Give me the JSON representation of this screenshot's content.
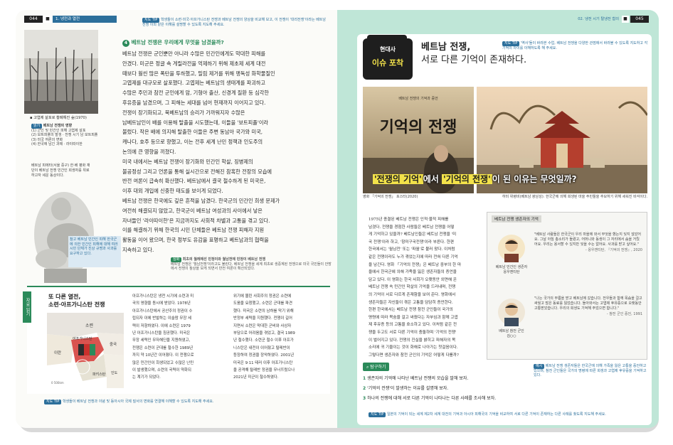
{
  "left_header": {
    "page": "044",
    "section_marker": "■",
    "chapter": "1. 냉전과 열전"
  },
  "right_header": {
    "chapter": "02. 냉전 시기 탈냉전 합의",
    "section_marker": "■",
    "page": "045"
  },
  "left_top_tip": {
    "tag": "지도 TIP",
    "text": "학생들이 소련·미국·아프가니스탄 전쟁과 베트남 전쟁의 양상을 비교해 보고, 이 전쟁이 '대리전쟁'이라는 베트남 전쟁 이외 같은 이해를 설명할 수 있도록 지도해 주세요."
  },
  "section4": {
    "num": "4",
    "title": "베트남 전쟁은 우리에게 무엇을 남겼을까?"
  },
  "left_body": [
    "베트남 전쟁은 군인뿐만 아니라 수많은 민간인에게도 막대한 피해를",
    "안겼다. 미군은 정글 속 게릴라전을 억제하기 위해 제초제 세계 대전",
    "때보다 훨씬 많은 폭탄을 투하했고, 밀림 제거를 위해 맹독성 화학물질인",
    "고엽제를 대규모로 살포했다. 고엽제는 베트남의 생태계를 파괴하고",
    "수많은 주민과 참전 군인에게 암, 기형아 출산, 신경계 질환 등 심각한",
    "후유증을 남겼으며, 그 피해는 세대를 넘어 현재까지 이어지고 있다.",
    "전쟁이 장기화되고, 북베트남의 승리가 가까워지자 수많은",
    "남베트남인이 배를 이용해 탈출을 시도했는데, 이들을 '보트피플'이라",
    "불렀다. 작은 배에 의지해 탈출한 이들은 주변 동남아 국가와 미국,",
    "캐나다, 호주 등으로 향했고, 이는 전후 세계 난민 정책과 인도주의",
    "논의에 큰 영향을 끼쳤다.",
    "미국 내에서는 베트남 전쟁이 장기화와 민간인 학살, 징병제의",
    "불공정성 그리고 언론을 통해 실시간으로 전해진 참혹한 전장의 모습에",
    "반전 여론이 급속히 확산했다. 베트남에서 결국 철수하게 된 미국은,",
    "이후 대외 개입에 신중한 태도를 보이게 되었다.",
    "베트남 전쟁은 한국에도 깊은 흔적을 남겼다. 한국군의 민간인 희생 문제가",
    "여전히 해결되지 않았고, 한국군이 베트남 여성과의 사이에서 낳은",
    "자녀들인 '라이따이한'은 지금까지도 사회적 차별과 고통을 겪고 있다.",
    "이를 해결하기 위해 한국의 시민 단체들은 베트남 전쟁 피해자 지원",
    "활동을 이어 왔으며, 한국 정부도 유감을 표명하고 베트남과의 협력을",
    "지속하고 있다."
  ],
  "photo1_caption": "고엽제 살포로 황폐해진 숲(1970)",
  "photo1_notes": {
    "tag": "읽기",
    "title": "베트남 전쟁의 영향",
    "items": [
      "(1) 군인 및 민간인 피해 고엽제 살포",
      "(2) 보트피플의 발생 · 전쟁 시기 남 보트피플",
      "(3) 미국 여론의 변화",
      "(4) 한국에 남긴 과제 · 라이따이한"
    ]
  },
  "statue_caption": "베트남 피에타(서울 중구) 한·베 평화 재단이 베트남 전쟁 민간인 희생자를 위로하고자 세운 동상이다.",
  "statue_note": "참고 베트남 민간인 피해 한국군에 의한 민간인 피해에 대해 여러 시민 단체가 진상 규명과 사과를 요구하고 있다.",
  "green_tip": {
    "tag": "심화",
    "title": "최초의 월레에선 민정이와 월남전에 민정이 베트남 전쟁",
    "text": "베트남 전쟁은 '월남전쟁'이라고도 불린다. 베트남 전쟁을 세계 최초로 생중계된 전쟁으로 미국 국민들이 안방에서 전쟁의 참상을 보게 되면서 반전 여론이 확산되었다."
  },
  "left_sidebar_label": "자료 읽기",
  "box2": {
    "title_line1": "또 다른 열전,",
    "title_line2": "소련·아프가니스탄 전쟁"
  },
  "map_labels": {
    "ussr": "소련",
    "afghanistan": "아프가니스탄",
    "iran": "이란",
    "china": "중국",
    "pakistan": "파키스탄",
    "india": "인도",
    "scale": "0 500km"
  },
  "box2_col1": [
    "아프가니스탄은 냉전 시기에 소련과 미",
    "국의 영향을 동시에 받았다. 1978년",
    "아프가니스탄에서 공산주의 정권이 수",
    "립되자 이에 반발하는 이슬람 무장 세",
    "력이 저항하였다. 이에 소련은 1979",
    "년 아프가니스탄을 침공했다. 미국은",
    "무장 세력인 무자헤딘을 지원하였고,",
    "전쟁은 소련이 군대를 철수한 1989년",
    "까지 약 10년간 이어졌다. 이 전쟁으로",
    "많은 민간인이 희생되었고 수많은 난민",
    "이 발생했으며, 소련의 국력이 약화되",
    "는 계기가 되었다."
  ],
  "box2_col2": [
    "위기에 몰린 사회주의 정권은 소련에",
    "도움을 요청했고, 소련은 군대를 파견",
    "했다. 미국은 소련의 남하를 막기 위해",
    "반정부 세력을 지원했다. 전쟁이 길어",
    "지면서 소련은 막대한 군비와 사상자",
    "부담으로 어려움을 겪었고, 결국 1989",
    "년 철수했다. 소련군 철수 이후 아프가",
    "니스탄은 내전이 이어졌고 탈레반이",
    "등장하여 정권을 장악하였다. 2001년",
    "미국은 9·11 테러 이후 아프가니스탄",
    "을 공격해 탈레반 정권을 무너뜨렸으나",
    "2021년 미군이 철수하였다."
  ],
  "left_bottom_tip": {
    "tag": "지도 TIP",
    "text": "학생들이 베트남 전쟁과 이념 및 동아시아 국제 질서의 변화를 연결해 이해할 수 있도록 지도해 주세요."
  },
  "badge": {
    "line1": "현대사",
    "line2": "이슈 포착"
  },
  "right_title": {
    "line1": "베트남 전쟁,",
    "line2": "서로 다른 기억이 존재하다."
  },
  "right_title_tip": {
    "tag": "지도 TIP",
    "text": "'역사'들이 바라본 수업, 베트남 전쟁을 다양한 관점에서 바라볼 수 있도록 지도하고 각 기억의 차이를 이해하도록 해 주세요."
  },
  "poster": {
    "small_text": "베트남 전쟁의 기억과 증언",
    "title": "기억의 전쟁",
    "caption": "영화 「기억의 전쟁」 포스터(2020)"
  },
  "temple_caption": "하미 위령비(베트남 꽝남성): 한국군에 의해 희생된 마을 주민들을 추모하기 위해 세워진 비석이다.",
  "banner": {
    "text": "'전쟁의 기억'에서 '기억의 전쟁'이 된 이유는 무엇일까?",
    "part1": "'전쟁의 기억'",
    "part2": "에서 ",
    "part3": "'기억의 전쟁'",
    "part4": "이 된 이유는 무엇일까?"
  },
  "right_body": [
    "1975년 종결된 베트남 전쟁은 인적·물적 피해를",
    "남겼다. 전쟁을 경험한 사람들은 베트남 전쟁을 어떻",
    "게 기억하고 있을까? 베트남인들은 베트남 전쟁을 '미",
    "국 전쟁'이라 하고, '항미구국전쟁'이라 부른다. 한편",
    "한국에서는 '월남전' 또는 '파월'로 불러 왔다. 이처럼",
    "같은 전쟁이라도 누가 겪었는지에 따라 전혀 다른 기억",
    "을 남긴다. 영화 「기억의 전쟁」은 베트남 중부의 한 마",
    "을에서 한국군에 의해 가족을 잃은 생존자들의 증언을",
    "담고 있다. 이 영화는 한국 사회가 오랫동안 외면해 온",
    "베트남 전쟁 속 민간인 학살의 기억을 드러내며, 전쟁",
    "의 기억이 서로 다르게 존재함을 보여 준다. 영화에서",
    "생존자들은 자신들이 겪은 고통을 담담히 증언한다.",
    "한편 한국에서는 베트남 전쟁 참전 군인들이 국가의",
    "명령에 따라 목숨을 걸고 싸웠다는 자부심과 함께 고엽",
    "제 후유증 등의 고통을 호소하고 있다. 이처럼 같은 전",
    "쟁을 두고도 서로 다른 기억이 충돌하며 '기억의 전쟁'",
    "이 벌어지고 있다. 전쟁의 진실을 밝히고 피해자의 목",
    "소리에 귀 기울이는 것이 화해로 나아가는 첫걸음이다.",
    "그렇다면 생존자와 참전 군인의 기억은 어떻게 다를까?"
  ],
  "testimony_box": {
    "title": "베트남 전쟁 생존자의 기억",
    "quote1": "\"베트남 사람들은 한국군이 우리 마을에 와서 무엇을 했는지 잊지 않았어요. 그날 아침 총소리가 들렸고, 어머니와 동생이 그 자리에서 숨을 거뒀어요. 우리는 용서할 수 있지만 잊을 수는 없어요. 사과를 받고 싶어요.\"",
    "source1": "- 응우옌티탄, 『기억의 전쟁』, 2020",
    "person1": "베트남 민간인 생존자",
    "person1_name": "응우옌티탄",
    "quote2": "\"나는 국가의 부름을 받고 베트남에 갔습니다. 전우들과 함께 목숨을 걸고 싸웠고 많은 동료를 잃었습니다. 돌아와서는 고엽제 후유증으로 오랫동안 고통받았습니다. 우리의 희생도 기억해 주었으면 합니다.\"",
    "source2": "- 참전 군인 증언, 1991",
    "person2": "베트남 참전 군인",
    "person2_name": "김○○"
  },
  "explore": {
    "label": "탐구하기",
    "q1": "생존자의 기억에 나타난 베트남 전쟁의 모습을 말해 보자.",
    "q2": "'기억의 전쟁'이 발생하는 이유를 설명해 보자.",
    "q3": "하나의 전쟁에 대해 서로 다른 기억이 나타나는 다른 사례를 조사해 보자."
  },
  "explore_tip": {
    "tag": "예시",
    "text": "베트남 전쟁 생존자들은 한국군에 의해 가족을 잃은 고통을 증언하고 있으며, 참전 군인들은 국가의 명령에 따른 희생과 고엽제 후유증을 기억하고 있다."
  },
  "right_bottom_tip": {
    "tag": "지도 TIP",
    "text": "일본의 기억이 되는 세계 제2차 세계 대전의 기억과 아시아 피해국의 기억을 비교하여 서로 다른 기억이 존재하는 다른 사례를 찾도록 지도해 주세요."
  },
  "colors": {
    "right_bg": "#bfe6d7",
    "accent": "#2c6f9b",
    "green": "#2b8a5a",
    "banner_yellow": "#f3e24a"
  }
}
